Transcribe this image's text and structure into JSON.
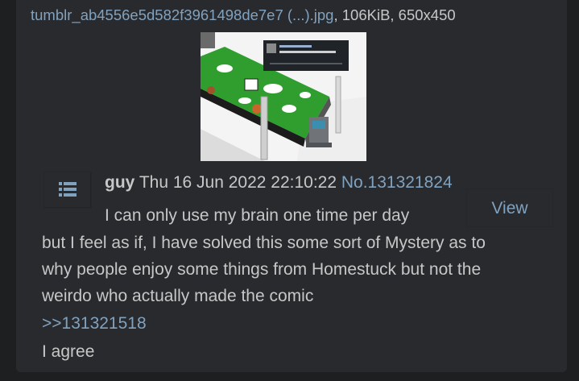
{
  "file": {
    "name": "tumblr_ab4556e5d582f3961498de7e7 (...).jpg",
    "meta": ", 106KiB, 650x450"
  },
  "post": {
    "name": "guy",
    "datetime": "Thu 16 Jun 2022 22:10:22",
    "number": "No.131321824",
    "view_label": "View",
    "lines": [
      "I can only use my brain one time per day",
      "but I feel as if, I have solved this some sort of Mystery as to",
      "why people enjoy some things from Homestuck but not the",
      "weirdo who actually made the comic"
    ],
    "quote": ">>131321518",
    "reply": "I agree"
  },
  "colors": {
    "background": "#1d1f21",
    "post_background": "#282a2e",
    "text": "#c5c8c6",
    "link": "#81a2be"
  },
  "icons": {
    "menu": "list-menu-icon"
  }
}
